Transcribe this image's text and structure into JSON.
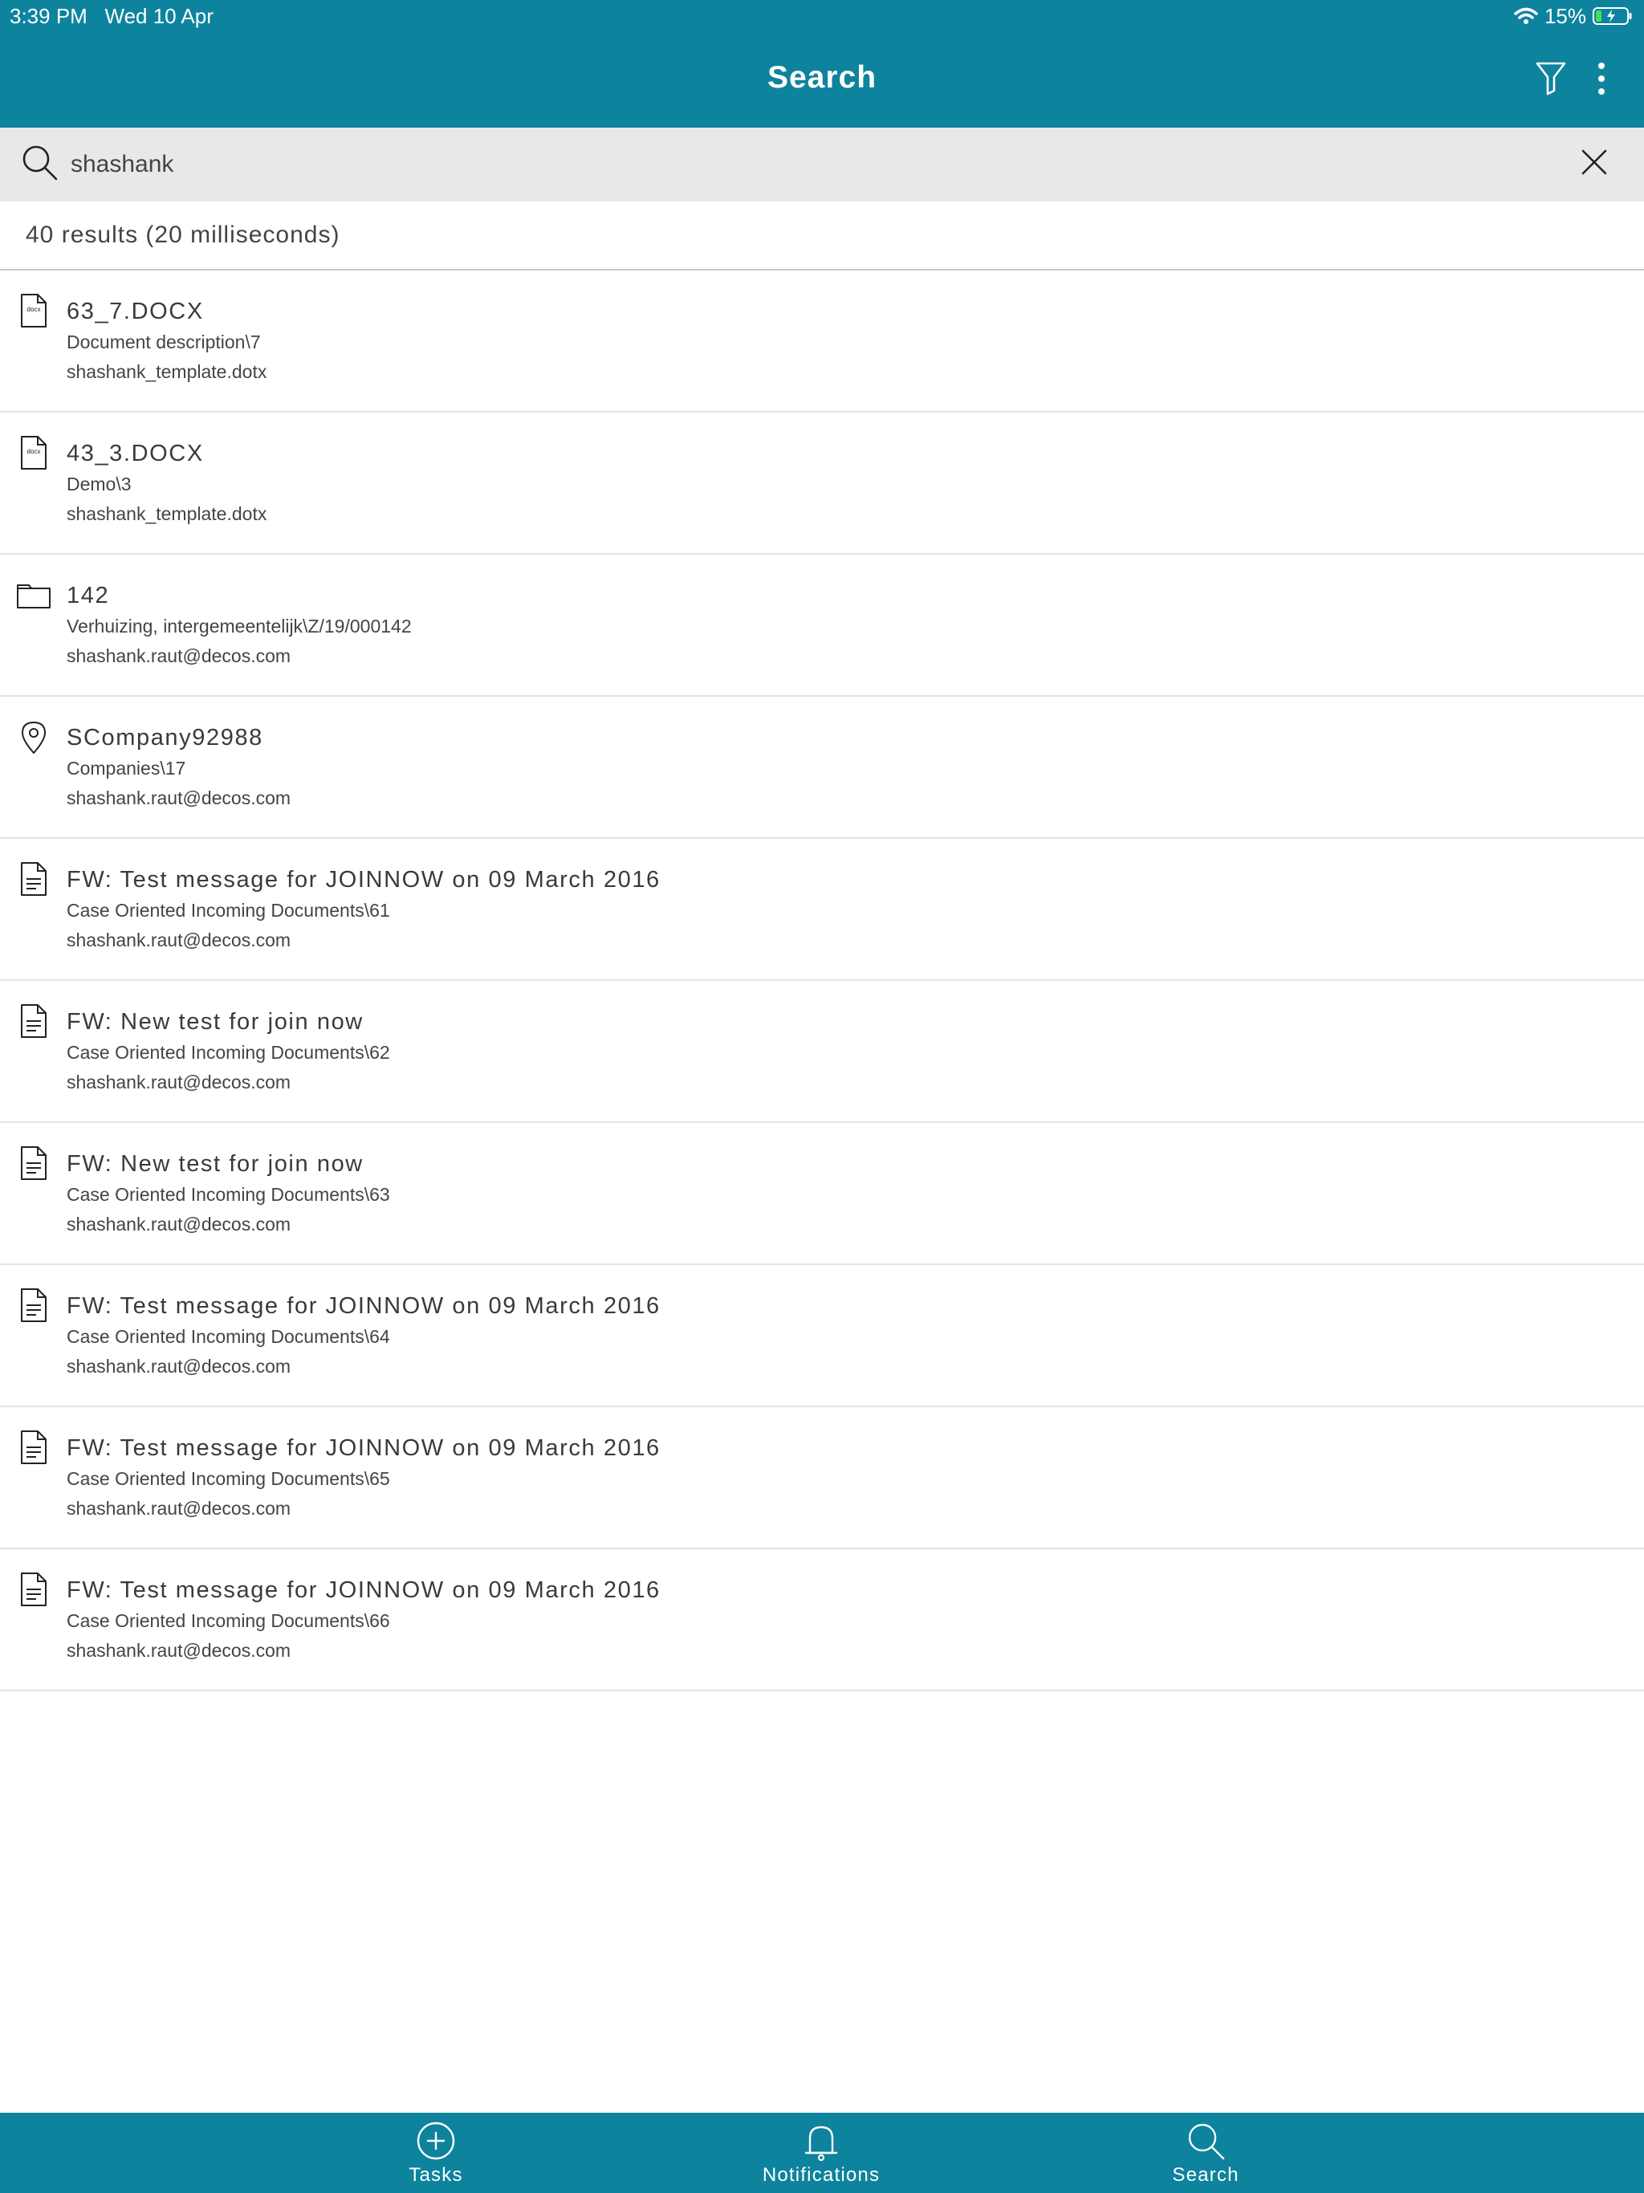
{
  "status_bar": {
    "time": "3:39 PM",
    "date": "Wed 10 Apr",
    "battery": "15%"
  },
  "nav": {
    "title": "Search"
  },
  "search": {
    "value": "shashank",
    "placeholder": ""
  },
  "results_summary": "40 results (20 milliseconds)",
  "results": [
    {
      "icon": "docx-file-icon",
      "title": "63_7.DOCX",
      "line1": "Document description\\7",
      "line2": "shashank_template.dotx"
    },
    {
      "icon": "docx-file-icon",
      "title": "43_3.DOCX",
      "line1": "Demo\\3",
      "line2": "shashank_template.dotx"
    },
    {
      "icon": "folder-icon",
      "title": "142",
      "line1": "Verhuizing, intergemeentelijk\\Z/19/000142",
      "line2": "shashank.raut@decos.com"
    },
    {
      "icon": "location-pin-icon",
      "title": "SCompany92988",
      "line1": "Companies\\17",
      "line2": "shashank.raut@decos.com"
    },
    {
      "icon": "document-icon",
      "title": "FW: Test message for JOINNOW on 09 March 2016",
      "line1": "Case Oriented Incoming Documents\\61",
      "line2": "shashank.raut@decos.com"
    },
    {
      "icon": "document-icon",
      "title": "FW: New test for join now",
      "line1": "Case Oriented Incoming Documents\\62",
      "line2": "shashank.raut@decos.com"
    },
    {
      "icon": "document-icon",
      "title": "FW: New test for join now",
      "line1": "Case Oriented Incoming Documents\\63",
      "line2": "shashank.raut@decos.com"
    },
    {
      "icon": "document-icon",
      "title": "FW: Test message for JOINNOW on 09 March 2016",
      "line1": "Case Oriented Incoming Documents\\64",
      "line2": "shashank.raut@decos.com"
    },
    {
      "icon": "document-icon",
      "title": "FW: Test message for JOINNOW on 09 March 2016",
      "line1": "Case Oriented Incoming Documents\\65",
      "line2": "shashank.raut@decos.com"
    },
    {
      "icon": "document-icon",
      "title": "FW: Test message for JOINNOW on 09 March 2016",
      "line1": "Case Oriented Incoming Documents\\66",
      "line2": "shashank.raut@decos.com"
    }
  ],
  "tabs": [
    {
      "label": "Tasks",
      "icon": "add-circle-icon"
    },
    {
      "label": "Notifications",
      "icon": "bell-icon"
    },
    {
      "label": "Search",
      "icon": "search-icon"
    }
  ],
  "colors": {
    "brand": "#0e839e",
    "search_bar_bg": "#e8e8e8",
    "divider": "#e3e3e3"
  }
}
